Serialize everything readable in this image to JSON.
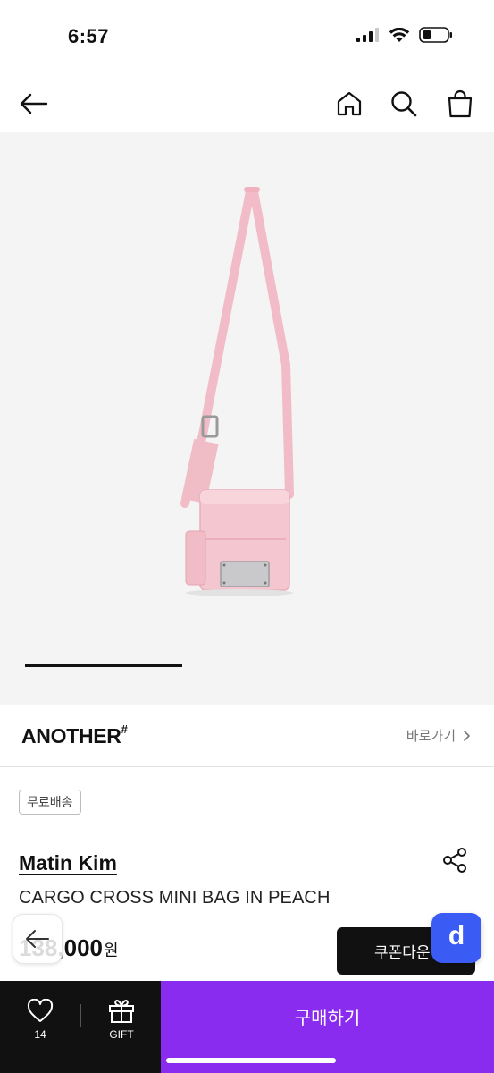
{
  "status_bar": {
    "time": "6:57"
  },
  "brand": {
    "logo_text": "ANOTHER",
    "logo_mark": "#",
    "link_label": "바로가기"
  },
  "product": {
    "badge": "무료배송",
    "brand_name": "Matin Kim",
    "title": "CARGO CROSS MINI BAG IN PEACH",
    "price": "138,000",
    "price_unit": "원",
    "image_color": "#f4c6cf"
  },
  "actions": {
    "coupon_label": "쿠폰다운",
    "like_count": "14",
    "gift_label": "GIFT",
    "buy_label": "구매하기"
  },
  "colors": {
    "buy_button": "#8a2cf0",
    "fab": "#3b5bf5",
    "bottom_bar": "#111111"
  },
  "icons": [
    "back-arrow-icon",
    "home-icon",
    "search-icon",
    "shopping-bag-icon",
    "share-icon",
    "heart-icon",
    "gift-icon",
    "app-d-icon"
  ]
}
